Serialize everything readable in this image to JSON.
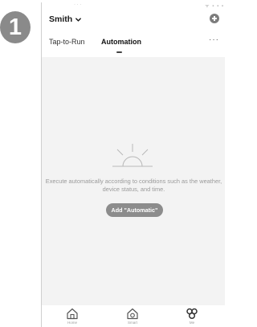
{
  "step_badge": {
    "number": "1"
  },
  "status_bar": {
    "left": "·  ·  ·",
    "right": "ᯤ ▪ ▪ ▪"
  },
  "header": {
    "home_name": "Smith",
    "add_icon": "plus-circle-icon",
    "more_label": "···"
  },
  "tabs": [
    {
      "label": "Tap-to-Run",
      "active": false
    },
    {
      "label": "Automation",
      "active": true
    }
  ],
  "empty_state": {
    "illustration": "sunrise-icon",
    "message": "Execute automatically according to conditions such as the weather, device status, and time.",
    "button_label": "Add \"Automatic\""
  },
  "tab_bar": [
    {
      "label": "Home",
      "icon": "home-icon"
    },
    {
      "label": "Smart",
      "icon": "smart-icon"
    },
    {
      "label": "Me",
      "icon": "me-icon"
    }
  ],
  "colors": {
    "badge": "#8a8a8a",
    "button": "#8c8c8c",
    "content_bg": "#f3f3f3",
    "text_muted": "#9a9a9a"
  }
}
